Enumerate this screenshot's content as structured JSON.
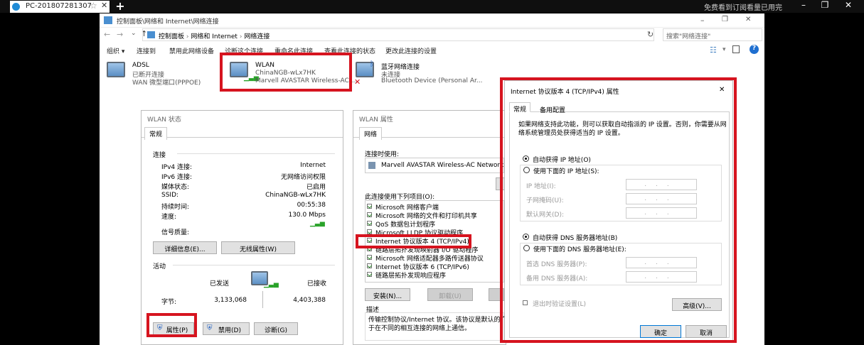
{
  "remote": {
    "tab_label": "PC-201807281307",
    "right_text": "免费看到订阅看量已用完",
    "star": "☆",
    "close": "✕",
    "new_tab": "+",
    "minimize": "–",
    "restore": "❐",
    "close_window": "✕"
  },
  "explorer": {
    "title": "控制面板\\网络和 Internet\\网络连接",
    "address": [
      "控制面板",
      "网络和 Internet",
      "网络连接"
    ],
    "search_placeholder": "搜索\"网络连接\"",
    "toolbar": [
      "组织 ▾",
      "连接到",
      "禁用此网络设备",
      "诊断这个连接",
      "重命名此连接",
      "查看此连接的状态",
      "更改此连接的设置"
    ],
    "connections": [
      {
        "name": "ADSL",
        "status": "已断开连接",
        "device": "WAN 微型端口(PPPOE)"
      },
      {
        "name": "WLAN",
        "status": "ChinaNGB-wLx7HK",
        "device": "Marvell AVASTAR Wireless-AC ..."
      },
      {
        "name": "蓝牙网络连接",
        "status": "未连接",
        "device": "Bluetooth Device (Personal Ar..."
      }
    ]
  },
  "status_dialog": {
    "title": "WLAN 状态",
    "tab": "常规",
    "section_connection": "连接",
    "rows": [
      {
        "label": "IPv4 连接:",
        "value": "Internet"
      },
      {
        "label": "IPv6 连接:",
        "value": "无网络访问权限"
      },
      {
        "label": "媒体状态:",
        "value": "已启用"
      },
      {
        "label": "SSID:",
        "value": "ChinaNGB-wLx7HK"
      },
      {
        "label": "持续时间:",
        "value": "00:55:38"
      },
      {
        "label": "速度:",
        "value": "130.0 Mbps"
      }
    ],
    "signal_label": "信号质量:",
    "details_btn": "详细信息(E)...",
    "wireless_btn": "无线属性(W)",
    "section_activity": "活动",
    "sent_label": "已发送",
    "recv_label": "已接收",
    "bytes_label": "字节:",
    "bytes_sent": "3,133,068",
    "bytes_recv": "4,403,388",
    "properties_btn": "属性(P)",
    "disable_btn": "禁用(D)",
    "diagnose_btn": "诊断(G)"
  },
  "props_dialog": {
    "title": "WLAN 属性",
    "tab": "网络",
    "connect_using": "连接时使用:",
    "adapter": "Marvell AVASTAR Wireless-AC Network Co",
    "items_label": "此连接使用下列项目(O):",
    "items": [
      {
        "label": "Microsoft 网络客户端",
        "checked": true
      },
      {
        "label": "Microsoft 网络的文件和打印机共享",
        "checked": true
      },
      {
        "label": "QoS 数据包计划程序",
        "checked": true
      },
      {
        "label": "Microsoft LLDP 协议驱动程序",
        "checked": true
      },
      {
        "label": "Internet 协议版本 4 (TCP/IPv4)",
        "checked": true
      },
      {
        "label": "链路层拓扑发现映射器 I/O 驱动程序",
        "checked": true
      },
      {
        "label": "Microsoft 网络适配器多路传送器协议",
        "checked": true
      },
      {
        "label": "Internet 协议版本 6 (TCP/IPv6)",
        "checked": true
      },
      {
        "label": "链路层拓扑发现响应程序",
        "checked": true
      }
    ],
    "install_btn": "安装(N)...",
    "uninstall_btn": "卸载(U)",
    "description_label": "描述",
    "description": "传输控制协议/Internet 协议。该协议是默认的广域网络协议，用于在不同的相互连接的网络上通信。",
    "description_line1": "传输控制协议/Internet 协议。该协议是默认的广",
    "description_line2": "于在不同的相互连接的网络上通信。"
  },
  "ipv4_dialog": {
    "title": "Internet 协议版本 4 (TCP/IPv4) 属性",
    "close": "✕",
    "tabs": [
      "常规",
      "备用配置"
    ],
    "intro_line1": "如果网络支持此功能，则可以获取自动指派的 IP 设置。否则，你需要从网",
    "intro_line2": "络系统管理员处获得适当的 IP 设置。",
    "auto_ip": "自动获得 IP 地址(O)",
    "manual_ip": "使用下面的 IP 地址(S):",
    "ip_address": "IP 地址(I):",
    "subnet": "子网掩码(U):",
    "gateway": "默认网关(D):",
    "auto_dns": "自动获得 DNS 服务器地址(B)",
    "manual_dns": "使用下面的 DNS 服务器地址(E):",
    "preferred_dns": "首选 DNS 服务器(P):",
    "alternate_dns": "备用 DNS 服务器(A):",
    "validate": "退出时验证设置(L)",
    "advanced_btn": "高级(V)...",
    "ok_btn": "确定",
    "cancel_btn": "取消",
    "ip_dots": "...",
    "auto_ip_selected": true,
    "auto_dns_selected": true
  }
}
